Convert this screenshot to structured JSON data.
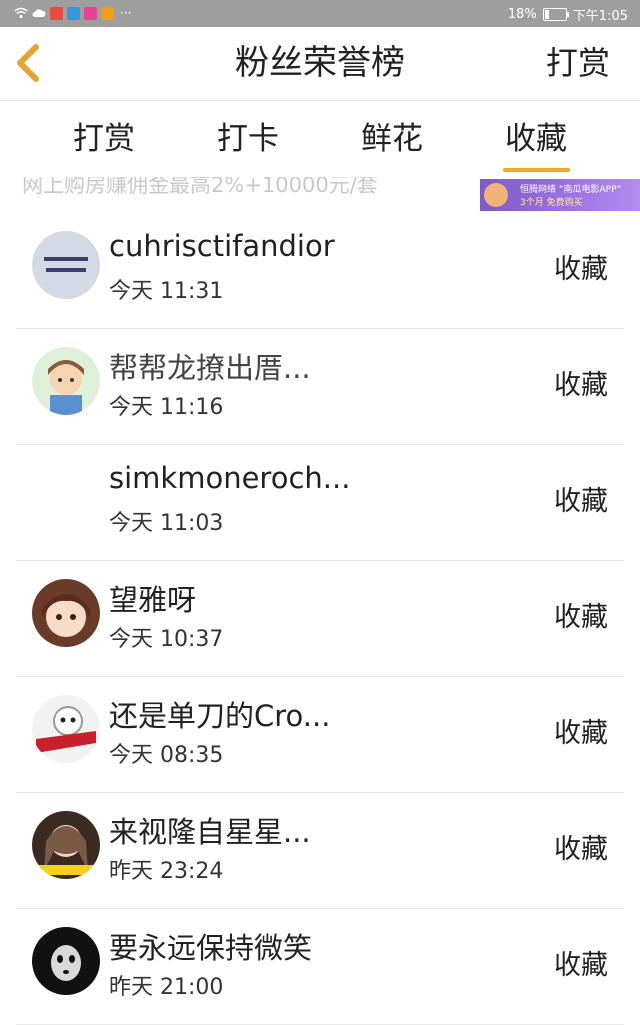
{
  "status_bar": {
    "battery": "18%",
    "time": "下午1:05",
    "overflow": "···"
  },
  "header": {
    "title": "粉丝荣誉榜",
    "right_button": "打赏",
    "back_icon": "chevron-left-icon",
    "accent_color": "#e0a63a"
  },
  "tabs": [
    {
      "label": "打赏",
      "active": false
    },
    {
      "label": "打卡",
      "active": false
    },
    {
      "label": "鲜花",
      "active": false
    },
    {
      "label": "收藏",
      "active": true
    }
  ],
  "ad": {
    "text": "网上购房赚佣金最高2%+10000元/套",
    "banner_line1": "恒腾网络 “南瓜电影APP”",
    "banner_line2": "3个月 免费购买"
  },
  "fans": [
    {
      "name": "cuhrisctifandior",
      "time": "今天 11:31",
      "action": "收藏",
      "avatar": "text-avatar"
    },
    {
      "name": "帮帮龙撩出厝...",
      "time": "今天 11:16",
      "action": "收藏",
      "avatar": "cartoon-boy-avatar"
    },
    {
      "name": "simkmoneroch...",
      "time": "今天 11:03",
      "action": "收藏",
      "avatar": "blank-avatar"
    },
    {
      "name": "望雅呀",
      "time": "今天 10:37",
      "action": "收藏",
      "avatar": "anime-girl-avatar"
    },
    {
      "name": "还是单刀的Cro...",
      "time": "今天 08:35",
      "action": "收藏",
      "avatar": "skeleton-avatar"
    },
    {
      "name": "来视隆自星星...",
      "time": "昨天 23:24",
      "action": "收藏",
      "avatar": "girl-photo-avatar"
    },
    {
      "name": "要永远保持微笑",
      "time": "昨天 21:00",
      "action": "收藏",
      "avatar": "mask-avatar"
    }
  ]
}
